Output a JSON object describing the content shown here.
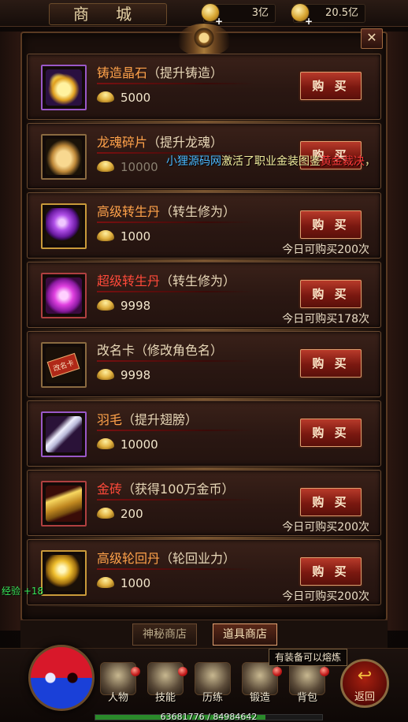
{
  "header": {
    "title": "商 城",
    "currency1": "3亿",
    "currency2": "20.5亿",
    "currency_plus": "+"
  },
  "close_label": "✕",
  "items": [
    {
      "name": "铸造晶石",
      "sub": "（提升铸造）",
      "price": "5000",
      "buy": "购 买",
      "limit": ""
    },
    {
      "name": "龙魂碎片",
      "sub": "（提升龙魂）",
      "price": "10000",
      "buy": "购 买",
      "limit": ""
    },
    {
      "name": "高级转生丹",
      "sub": "（转生修为）",
      "price": "1000",
      "buy": "购 买",
      "limit": "今日可购买200次"
    },
    {
      "name": "超级转生丹",
      "sub": "（转生修为）",
      "price": "9998",
      "buy": "购 买",
      "limit": "今日可购买178次"
    },
    {
      "name": "改名卡",
      "sub": "（修改角色名）",
      "price": "9998",
      "buy": "购 买",
      "limit": ""
    },
    {
      "name": "羽毛",
      "sub": "（提升翅膀）",
      "price": "10000",
      "buy": "购 买",
      "limit": ""
    },
    {
      "name": "金砖",
      "sub": "（获得100万金币）",
      "price": "200",
      "buy": "购 买",
      "limit": "今日可购买200次"
    },
    {
      "name": "高级轮回丹",
      "sub": "（轮回业力）",
      "price": "1000",
      "buy": "购 买",
      "limit": "今日可购买200次"
    }
  ],
  "icons": [
    "crystal-icon",
    "dragon-soul-icon",
    "purple-pill-icon",
    "super-pill-icon",
    "rename-card-icon",
    "feather-icon",
    "gold-brick-icon",
    "golden-pill-icon"
  ],
  "rename_card_text": "改名卡",
  "broadcast": {
    "part1": "小狸源码网",
    "part2": "激活了职业金装图鉴",
    "part3": "黄金裁决",
    "part4": "，"
  },
  "exp_gain": "经验 +18",
  "tabs": {
    "mystery": "神秘商店",
    "items": "道具商店"
  },
  "tooltip": "有装备可以熔炼",
  "hud": {
    "character": "人物",
    "skills": "技能",
    "training": "历练",
    "forge": "锻造",
    "bag": "背包",
    "back": "返回",
    "exp_numbers": "63681776 / 84984642",
    "exp_ratio": 0.749
  }
}
